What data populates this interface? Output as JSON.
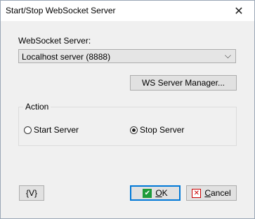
{
  "window": {
    "title": "Start/Stop WebSocket Server",
    "close_glyph": "✕"
  },
  "server": {
    "label": "WebSocket Server:",
    "selected": "Localhost server (8888)",
    "chevron": "⌵"
  },
  "buttons": {
    "ws_manager": "WS Server Manager...",
    "variables": "{V}",
    "ok_first": "O",
    "ok_rest": "K",
    "cancel_first": "C",
    "cancel_rest": "ancel"
  },
  "action": {
    "group_label": "Action",
    "options": [
      {
        "label": "Start Server",
        "selected": false
      },
      {
        "label": "Stop Server",
        "selected": true
      }
    ]
  },
  "icons": {
    "ok": "check-icon",
    "cancel": "cancel-icon",
    "ok_color": "#1e9b3b",
    "cancel_color": "#cc0000"
  }
}
